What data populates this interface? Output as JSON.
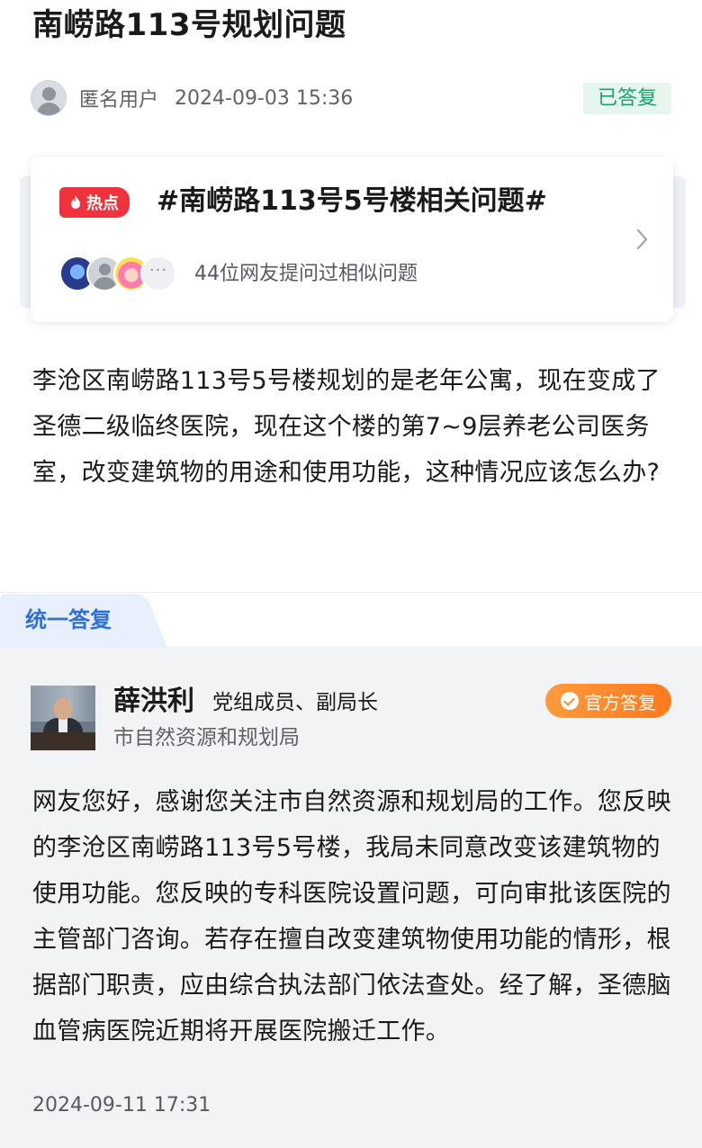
{
  "post": {
    "title": "南崂路113号规划问题",
    "author": "匿名用户",
    "time": "2024-09-03 15:36",
    "status": "已答复"
  },
  "hot_topic": {
    "badge": "热点",
    "title": "#南崂路113号5号楼相关问题#",
    "more_avatars": "···",
    "similar_text": "44位网友提问过相似问题"
  },
  "question": "李沧区南崂路113号5号楼规划的是老年公寓，现在变成了圣德二级临终医院，现在这个楼的第7~9层养老公司医务室，改变建筑物的用途和使用功能，这种情况应该怎么办?",
  "answer_section": {
    "tab_label": "统一答复",
    "responder_name": "薛洪利",
    "responder_role": "党组成员、副局长",
    "department": "市自然资源和规划局",
    "official_badge": "官方答复",
    "answer_text": "网友您好，感谢您关注市自然资源和规划局的工作。您反映的李沧区南崂路113号5号楼，我局未同意改变该建筑物的使用功能。您反映的专科医院设置问题，可向审批该医院的主管部门咨询。若存在擅自改变建筑物使用功能的情形，根据部门职责，应由综合执法部门依法查处。经了解，圣德脑血管病医院近期将开展医院搬迁工作。",
    "answer_time": "2024-09-11 17:31"
  },
  "colors": {
    "status_green": "#1aa36a",
    "hot_red": "#f0323c",
    "tab_blue": "#2f6fd8",
    "official_orange": "#ff8a2a"
  },
  "icons": [
    "user-avatar-icon",
    "flame-icon",
    "chevron-right-icon",
    "check-badge-icon"
  ]
}
